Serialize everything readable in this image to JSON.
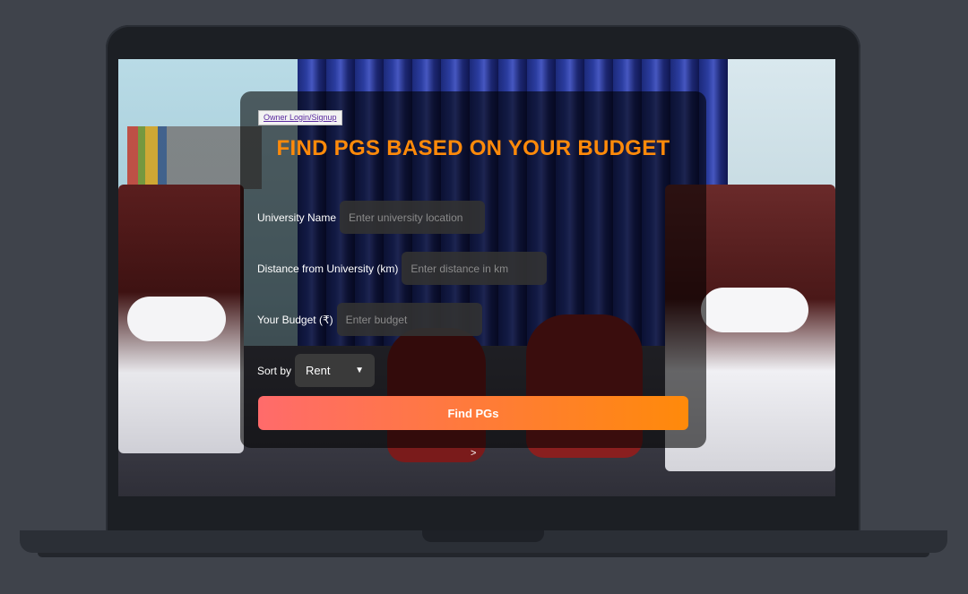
{
  "owner_link": "Owner Login/Signup",
  "title": "FIND PGS BASED ON YOUR BUDGET",
  "fields": {
    "university": {
      "label": "University Name",
      "placeholder": "Enter university location"
    },
    "distance": {
      "label": "Distance from University (km)",
      "placeholder": "Enter distance in km"
    },
    "budget": {
      "label": "Your Budget (₹)",
      "placeholder": "Enter budget"
    }
  },
  "sort": {
    "label": "Sort by",
    "selected": "Rent"
  },
  "find_button": "Find PGs",
  "stray_text": ">",
  "colors": {
    "title": "#ff8a0a",
    "button_start": "#ff6b6b",
    "button_end": "#ff8a0a"
  }
}
